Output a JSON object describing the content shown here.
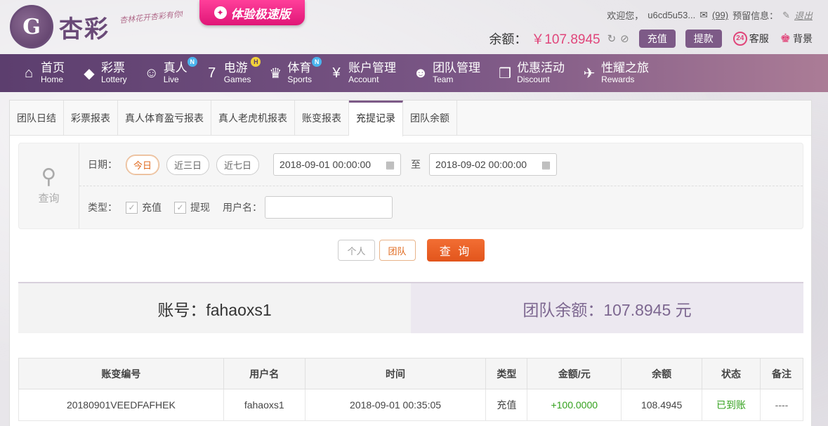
{
  "brand": {
    "logo_text": "杏彩",
    "slogan": "杏林花开杏彩有你!",
    "promo_label": "体验极速版"
  },
  "user": {
    "welcome": "欢迎您，",
    "username": "u6cd5u53...",
    "msg_count": "(99)",
    "reserve_label": "预留信息：",
    "logout": "退出",
    "balance_label": "余额：",
    "balance_value": "￥107.8945",
    "deposit_btn": "充值",
    "withdraw_btn": "提款",
    "service_label": "客服",
    "service_icon_text": "24",
    "background_label": "背景"
  },
  "nav": [
    {
      "cn": "首页",
      "en": "Home",
      "icon": "home-icon",
      "glyph": "⌂",
      "badge": ""
    },
    {
      "cn": "彩票",
      "en": "Lottery",
      "icon": "lottery-icon",
      "glyph": "◆",
      "badge": ""
    },
    {
      "cn": "真人",
      "en": "Live",
      "icon": "live-icon",
      "glyph": "☺",
      "badge": "N"
    },
    {
      "cn": "电游",
      "en": "Games",
      "icon": "games-icon",
      "glyph": "7",
      "badge": "H"
    },
    {
      "cn": "体育",
      "en": "Sports",
      "icon": "trophy-icon",
      "glyph": "♛",
      "badge": "N"
    },
    {
      "cn": "账户管理",
      "en": "Account",
      "icon": "account-icon",
      "glyph": "¥",
      "badge": ""
    },
    {
      "cn": "团队管理",
      "en": "Team",
      "icon": "team-icon",
      "glyph": "☻",
      "badge": ""
    },
    {
      "cn": "优惠活动",
      "en": "Discount",
      "icon": "gift-icon",
      "glyph": "❒",
      "badge": ""
    },
    {
      "cn": "性耀之旅",
      "en": "Rewards",
      "icon": "rewards-icon",
      "glyph": "✈",
      "badge": ""
    }
  ],
  "tabs": [
    "团队日结",
    "彩票报表",
    "真人体育盈亏报表",
    "真人老虎机报表",
    "账变报表",
    "充提记录",
    "团队余额"
  ],
  "active_tab": 5,
  "query": {
    "side_label": "查询",
    "date_label": "日期：",
    "quick_ranges": [
      "今日",
      "近三日",
      "近七日"
    ],
    "start": "2018-09-01 00:00:00",
    "to_label": "至",
    "end": "2018-09-02 00:00:00",
    "type_label": "类型：",
    "type_options": [
      "充值",
      "提现"
    ],
    "username_label": "用户名：",
    "username_value": ""
  },
  "scope": {
    "personal": "个人",
    "team": "团队",
    "search": "查 询"
  },
  "summary": {
    "account": "账号：fahaoxs1",
    "team_balance": "团队余额：107.8945 元"
  },
  "table": {
    "headers": [
      "账变编号",
      "用户名",
      "时间",
      "类型",
      "金额/元",
      "余额",
      "状态",
      "备注"
    ],
    "rows": [
      [
        "20180901VEEDFAFHEK",
        "fahaoxs1",
        "2018-09-01 00:35:05",
        "充值",
        "+100.0000",
        "108.4945",
        "已到账",
        "----"
      ]
    ]
  },
  "colors": {
    "nav_start": "#5c3e6e",
    "nav_end": "#ab7c96",
    "accent_pink": "#e0457a",
    "search_orange": "#e2551c",
    "success_green": "#33a11d"
  }
}
